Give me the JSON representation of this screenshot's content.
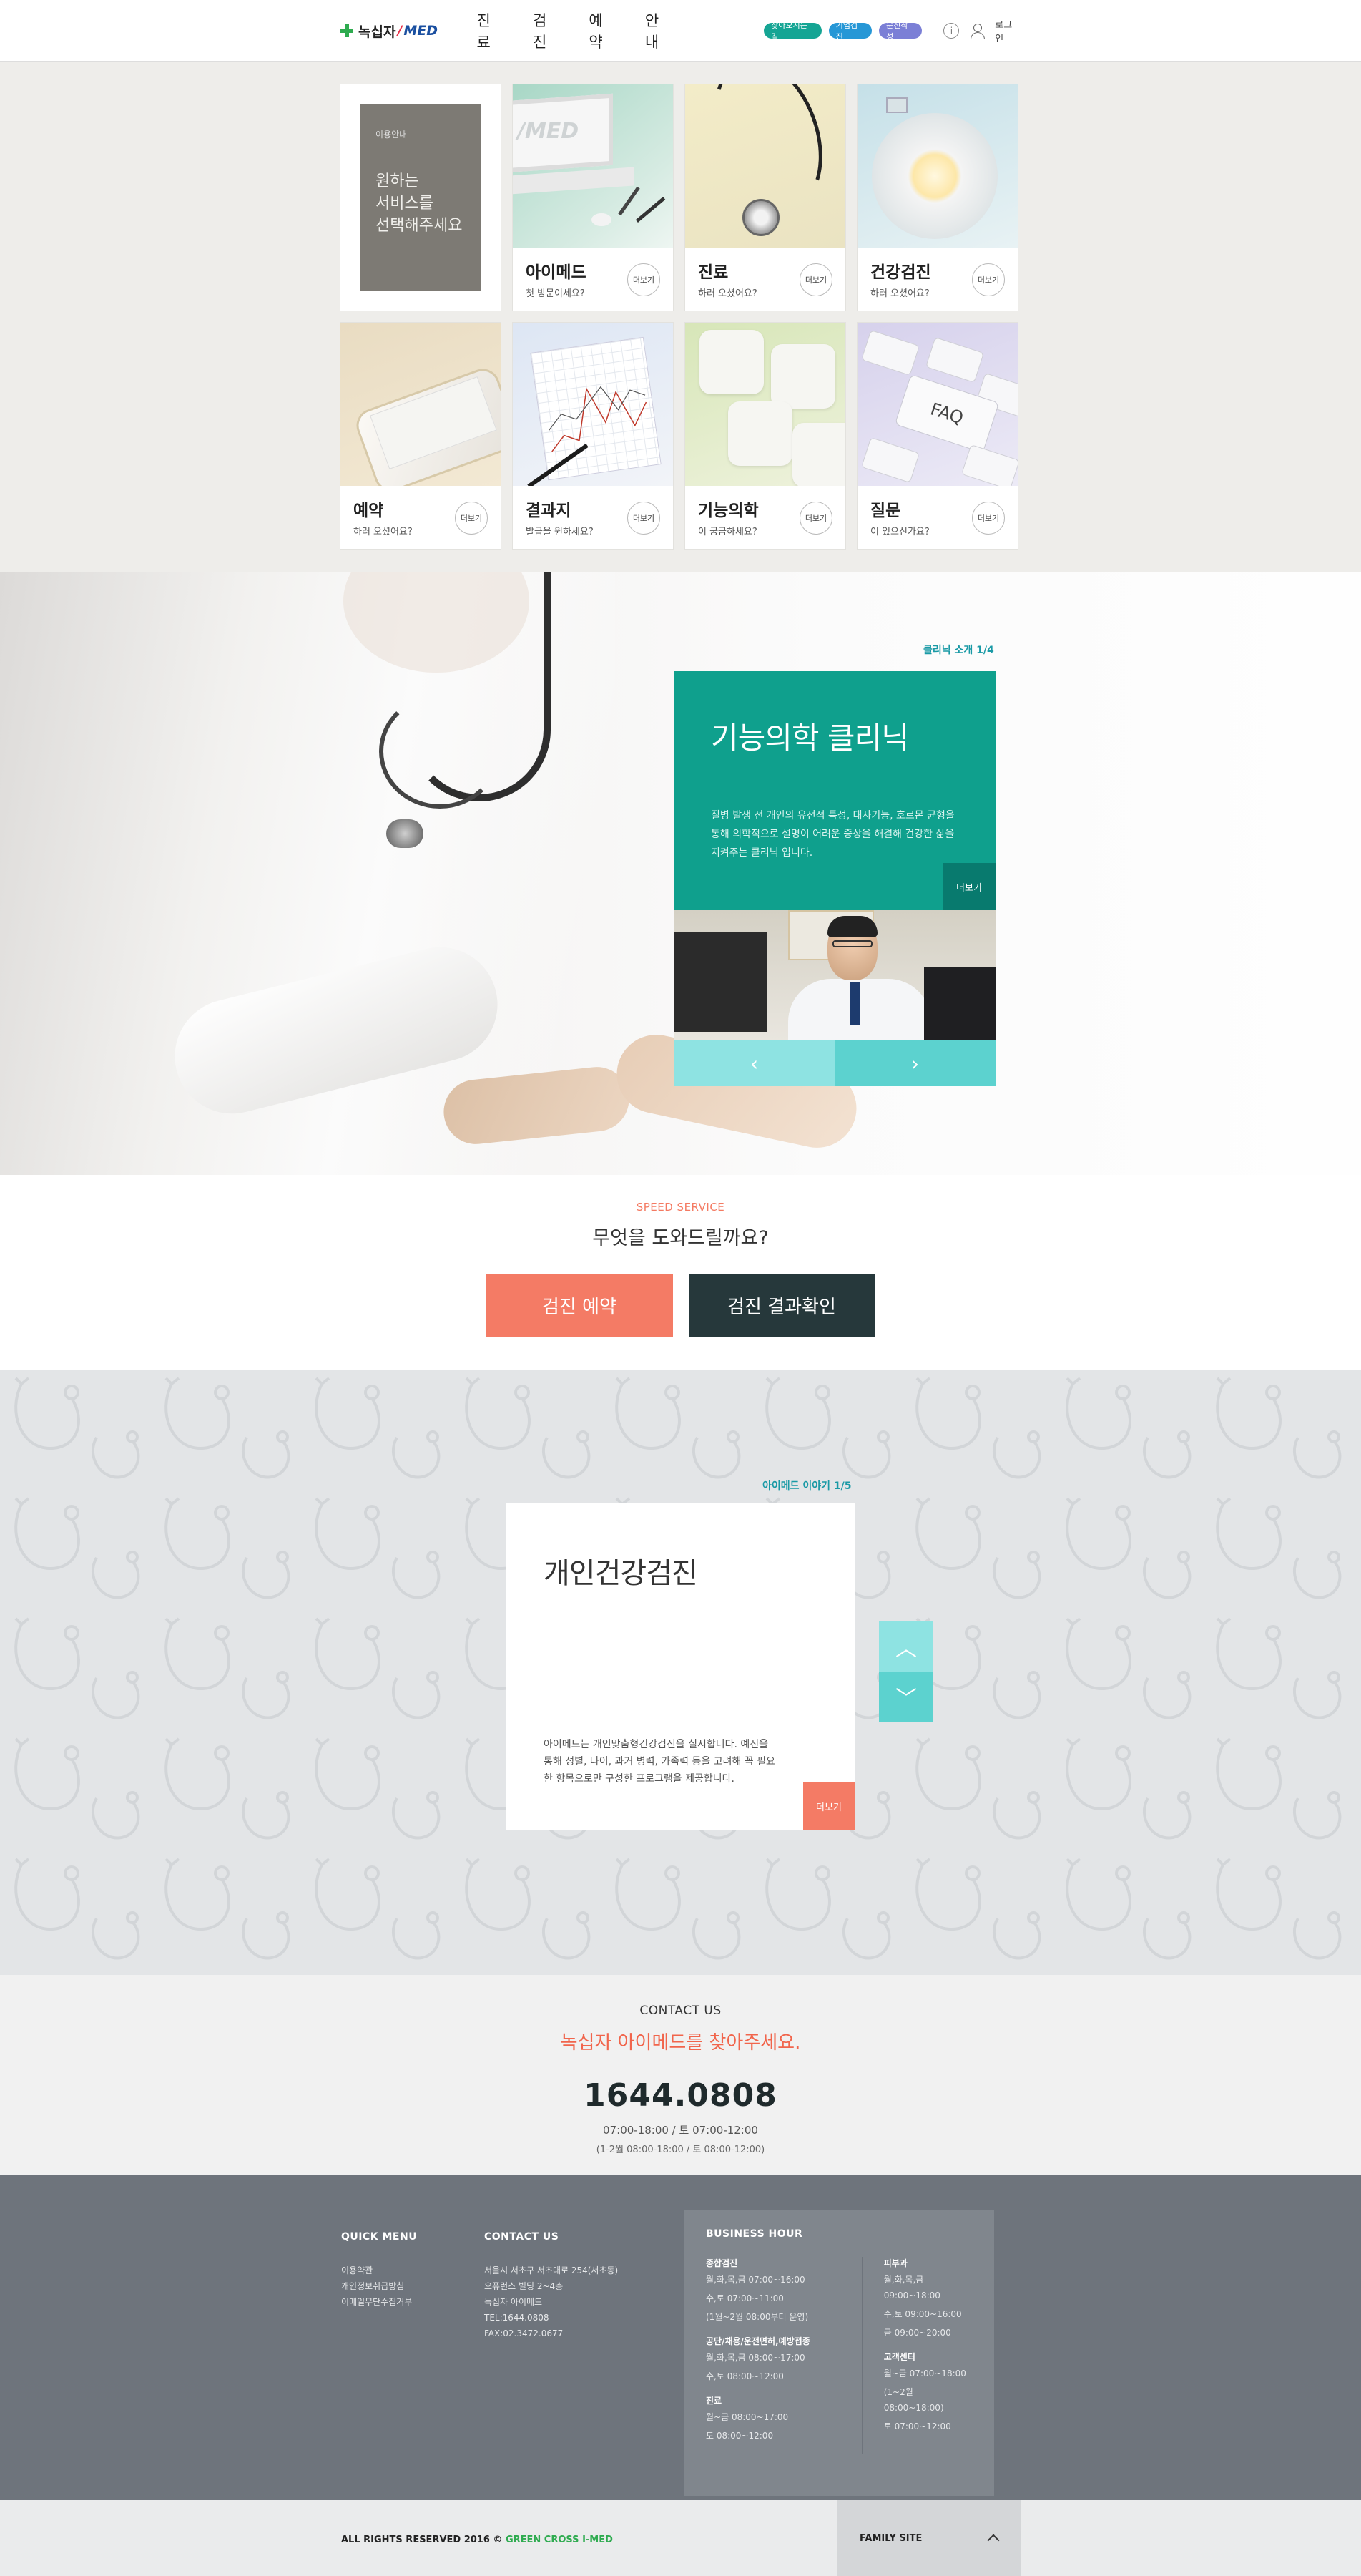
{
  "header": {
    "logo_text": "녹십자",
    "logo_slash": "/",
    "logo_med": "MED",
    "nav": [
      "진료",
      "검진",
      "예약",
      "안내"
    ],
    "pills": [
      "찾아오시는길",
      "기업검진",
      "문진작성"
    ],
    "info_icon": "i",
    "login": "로그인"
  },
  "services": {
    "intro_small": "이용안내",
    "intro_lines": [
      "원하는",
      "서비스를",
      "선택해주세요"
    ],
    "more_label": "더보기",
    "cards": [
      {
        "title": "아이메드",
        "sub": "첫 방문이세요?"
      },
      {
        "title": "진료",
        "sub": "하러 오셨어요?"
      },
      {
        "title": "건강검진",
        "sub": "하러 오셨어요?"
      },
      {
        "title": "예약",
        "sub": "하러 오셨어요?"
      },
      {
        "title": "결과지",
        "sub": "발급을 원하세요?"
      },
      {
        "title": "기능의학",
        "sub": "이 궁금하세요?"
      },
      {
        "title": "질문",
        "sub": "이 있으신가요?"
      }
    ],
    "laptop_brand": "/MED",
    "faq_key": "FAQ"
  },
  "clinic": {
    "counter": "클리닉 소개 1/4",
    "title": "기능의학 클리닉",
    "desc": "질병 발생 전 개인의 유전적 특성, 대사기능, 호르몬 균형을 통해 의학적으로 설명이 어려운 증상을 해결해 건강한 삶을 지켜주는 클리닉 입니다.",
    "more": "더보기",
    "prev": "‹",
    "next": "›"
  },
  "speed": {
    "label": "SPEED SERVICE",
    "question": "무엇을 도와드릴까요?",
    "btn1": "검진 예약",
    "btn2": "검진 결과확인"
  },
  "story": {
    "counter": "아이메드 이야기 1/5",
    "title": "개인건강검진",
    "desc": "아이메드는 개인맞춤형건강검진을 실시합니다. 예진을 통해 성별, 나이, 과거 병력, 가족력 등을 고려해 꼭 필요한 항목으로만 구성한 프로그램을 제공합니다.",
    "more": "더보기",
    "up": "︿",
    "down": "﹀"
  },
  "contact": {
    "label": "CONTACT US",
    "slogan": "녹십자 아이메드를 찾아주세요.",
    "tel": "1644.0808",
    "hours": "07:00-18:00 / 토 07:00-12:00",
    "hours2": "(1-2월 08:00-18:00 / 토 08:00-12:00)"
  },
  "footer": {
    "quick_title": "QUICK MENU",
    "quick_items": [
      "이용약관",
      "개인정보취급방침",
      "이메일무단수집거부"
    ],
    "contact_title": "CONTACT US",
    "contact_items": [
      "서울시 서초구 서초대로 254(서초동)",
      "오퓨런스 빌딩 2~4층",
      "녹십자 아이메드",
      "TEL:1644.0808",
      "FAX:02.3472.0677"
    ],
    "bh_title": "BUSINESS HOUR",
    "bh_left": [
      {
        "title": "종합검진",
        "lines": [
          "월,화,목,금 07:00~16:00",
          "수,토 07:00~11:00",
          "(1월~2월 08:00부터 운영)"
        ]
      },
      {
        "title": "공단/채용/운전면허,예방접종",
        "lines": [
          "월,화,목,금 08:00~17:00",
          "수,토 08:00~12:00"
        ]
      },
      {
        "title": "진료",
        "lines": [
          "월~금 08:00~17:00",
          "토 08:00~12:00"
        ]
      }
    ],
    "bh_right": [
      {
        "title": "피부과",
        "lines": [
          "월,화,목,금 09:00~18:00",
          "수,토 09:00~16:00",
          "금 09:00~20:00"
        ]
      },
      {
        "title": "고객센터",
        "lines": [
          "월~금 07:00~18:00",
          "(1~2월 08:00~18:00)",
          "토 07:00~12:00"
        ]
      }
    ]
  },
  "bottom": {
    "copy": "ALL RIGHTS RESERVED 2016 © ",
    "copy_brand": "GREEN CROSS I-MED",
    "family": "FAMILY SITE"
  }
}
